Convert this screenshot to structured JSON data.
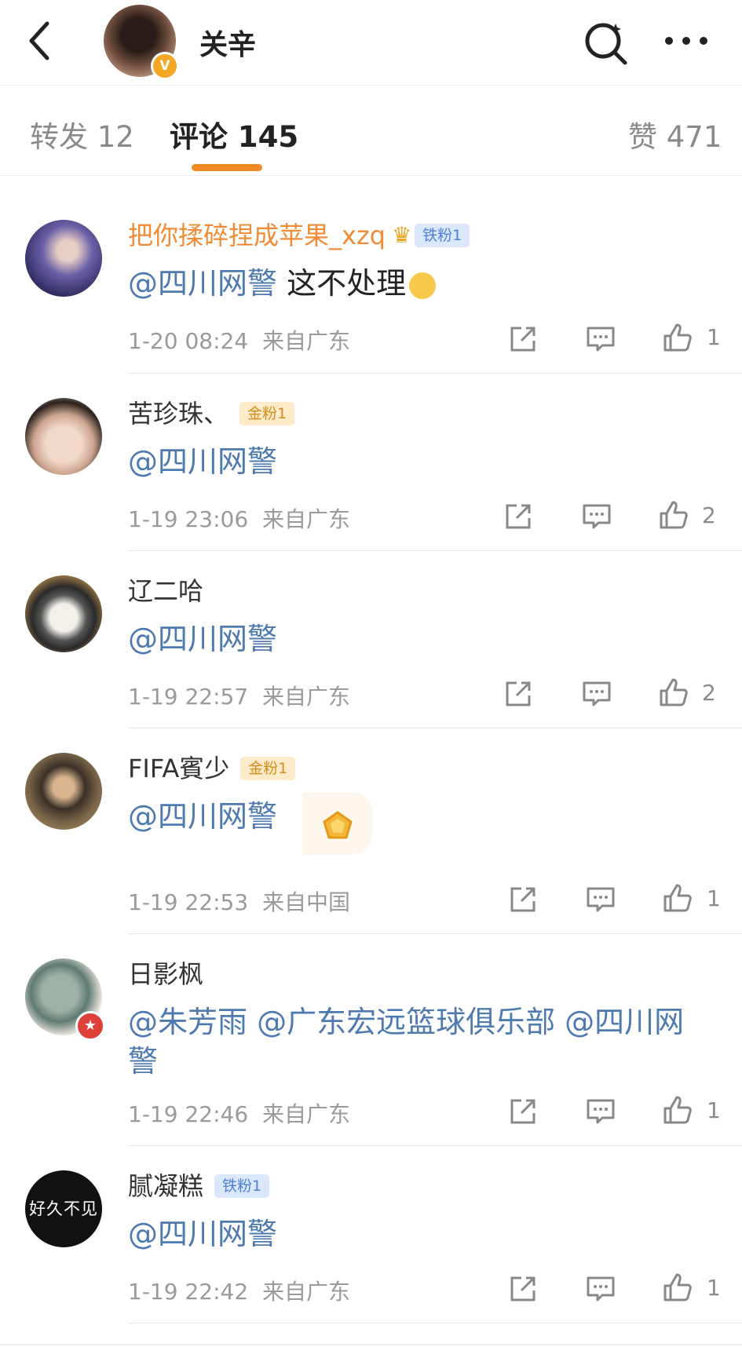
{
  "header": {
    "author_name": "关辛",
    "verified_mark": "V"
  },
  "tabs": {
    "repost": "转发 12",
    "comments": "评论 145",
    "likes": "赞 471"
  },
  "comments": [
    {
      "name": "把你揉碎捏成苹果_xzq",
      "badge": "铁粉1",
      "mention": "@四川网警",
      "text": " 这不处理",
      "time": "1-20 08:24",
      "location": "来自广东",
      "likes": "1"
    },
    {
      "name": "苦珍珠、",
      "badge": "金粉1",
      "mention": "@四川网警",
      "time": "1-19 23:06",
      "location": "来自广东",
      "likes": "2"
    },
    {
      "name": "辽二哈",
      "mention": "@四川网警",
      "time": "1-19 22:57",
      "location": "来自广东",
      "likes": "2"
    },
    {
      "name": "FIFA賓少",
      "badge": "金粉1",
      "mention": "@四川网警",
      "time": "1-19 22:53",
      "location": "来自中国",
      "likes": "1"
    },
    {
      "name": "日影枫",
      "mentions": "@朱芳雨 @广东宏远篮球俱乐部 @四川网警",
      "time": "1-19 22:46",
      "location": "来自广东",
      "likes": "1"
    },
    {
      "name": "腻凝糕",
      "badge": "铁粉1",
      "mention": "@四川网警",
      "time": "1-19 22:42",
      "location": "来自广东",
      "likes": "1",
      "avatar_text": "好久不见"
    }
  ],
  "icons": {
    "share": "share-icon",
    "reply": "comment-icon",
    "like": "thumbs-up-icon"
  },
  "colors": {
    "accent": "#f08a24",
    "mention": "#4e7ab0"
  }
}
